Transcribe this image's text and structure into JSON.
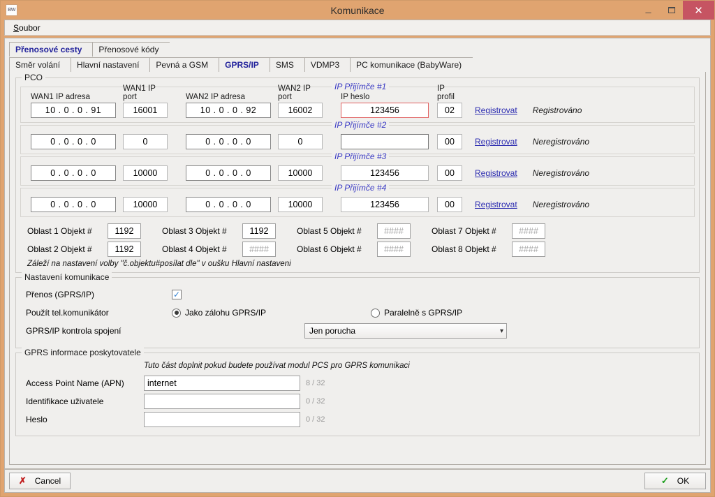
{
  "window": {
    "title": "Komunikace",
    "app_icon": "BW",
    "minimize": "minimize-icon",
    "maximize": "maximize-icon",
    "close": "close-icon",
    "close_color": "#c65462",
    "titlebar_color": "#e0a470"
  },
  "menubar": {
    "items": [
      {
        "label": "Soubor",
        "accel": "S"
      }
    ]
  },
  "tabs": {
    "row1": [
      {
        "label": "Přenosové cesty",
        "active": true
      },
      {
        "label": "Přenosové kódy",
        "active": false
      }
    ],
    "row2": [
      {
        "label": "Směr volání",
        "active": false
      },
      {
        "label": "Hlavní nastavení",
        "active": false
      },
      {
        "label": "Pevná a GSM",
        "active": false
      },
      {
        "label": "GPRS/IP",
        "active": true
      },
      {
        "label": "SMS",
        "active": false
      },
      {
        "label": "VDMP3",
        "active": false
      },
      {
        "label": "PC komunikace (BabyWare)",
        "active": false
      }
    ]
  },
  "pco": {
    "legend": "PCO",
    "headers": {
      "wan1_ip": "WAN1 IP adresa",
      "wan1_port": "WAN1 IP port",
      "wan2_ip": "WAN2 IP adresa",
      "wan2_port": "WAN2 IP port",
      "ip_password": "IP heslo",
      "ip_profile": "IP profil"
    },
    "register_link": "Registrovat",
    "receivers": [
      {
        "legend": "IP Přijímče #1",
        "wan1_ip": "10 . 0 . 0 . 91",
        "wan1_port": "16001",
        "wan2_ip": "10 . 0 . 0 . 92",
        "wan2_port": "16002",
        "ip_password": "123456",
        "ip_profile": "02",
        "register": "Registrovat",
        "status": "Registrováno",
        "password_error": true
      },
      {
        "legend": "IP Přijímče #2",
        "wan1_ip": "0 . 0 . 0 . 0",
        "wan1_port": "0",
        "wan2_ip": "0 . 0 . 0 . 0",
        "wan2_port": "0",
        "ip_password": "",
        "ip_profile": "00",
        "register": "Registrovat",
        "status": "Neregistrováno",
        "password_error": false
      },
      {
        "legend": "IP Přijímče #3",
        "wan1_ip": "0 . 0 . 0 . 0",
        "wan1_port": "10000",
        "wan2_ip": "0 . 0 . 0 . 0",
        "wan2_port": "10000",
        "ip_password": "123456",
        "ip_profile": "00",
        "register": "Registrovat",
        "status": "Neregistrováno",
        "password_error": false
      },
      {
        "legend": "IP Přijímče #4",
        "wan1_ip": "0 . 0 . 0 . 0",
        "wan1_port": "10000",
        "wan2_ip": "0 . 0 . 0 . 0",
        "wan2_port": "10000",
        "ip_password": "123456",
        "ip_profile": "00",
        "register": "Registrovat",
        "status": "Neregistrováno",
        "password_error": false
      }
    ],
    "oblast": [
      {
        "label": "Oblast 1 Objekt #",
        "value": "1192",
        "placeholder": false
      },
      {
        "label": "Oblast 3 Objekt #",
        "value": "1192",
        "placeholder": false
      },
      {
        "label": "Oblast 5 Objekt #",
        "value": "####",
        "placeholder": true
      },
      {
        "label": "Oblast 7 Objekt #",
        "value": "####",
        "placeholder": true
      },
      {
        "label": "Oblast 2 Objekt #",
        "value": "1192",
        "placeholder": false
      },
      {
        "label": "Oblast 4 Objekt #",
        "value": "####",
        "placeholder": true
      },
      {
        "label": "Oblast 6 Objekt #",
        "value": "####",
        "placeholder": true
      },
      {
        "label": "Oblast 8 Objekt #",
        "value": "####",
        "placeholder": true
      }
    ],
    "note": "Záleží na nastavení volby \"č.objektu#posílat dle\" v oušku Hlavní nastaveni"
  },
  "comm_settings": {
    "legend": "Nastavení komunikace",
    "transfer_label": "Přenos (GPRS/IP)",
    "transfer_checked": true,
    "tel_label": "Použít tel.komunikátor",
    "tel_option_1": "Jako zálohu GPRS/IP",
    "tel_option_2": "Paralelně s GPRS/IP",
    "tel_selected": 1,
    "supervision_label": "GPRS/IP kontrola spojení",
    "supervision_value": "Jen porucha"
  },
  "gprs_info": {
    "legend": "GPRS informace poskytovatele",
    "note": "Tuto část doplnit pokud budete používat modul PCS pro GPRS komunikaci",
    "rows": [
      {
        "label": "Access Point Name (APN)",
        "value": "internet",
        "counter": "8 / 32"
      },
      {
        "label": "Identifikace uživatele",
        "value": "",
        "counter": "0 / 32"
      },
      {
        "label": "Heslo",
        "value": "",
        "counter": "0 / 32"
      }
    ]
  },
  "footer": {
    "cancel": "Cancel",
    "ok": "OK",
    "cancel_icon": "x-mark-icon",
    "ok_icon": "check-mark-icon"
  }
}
